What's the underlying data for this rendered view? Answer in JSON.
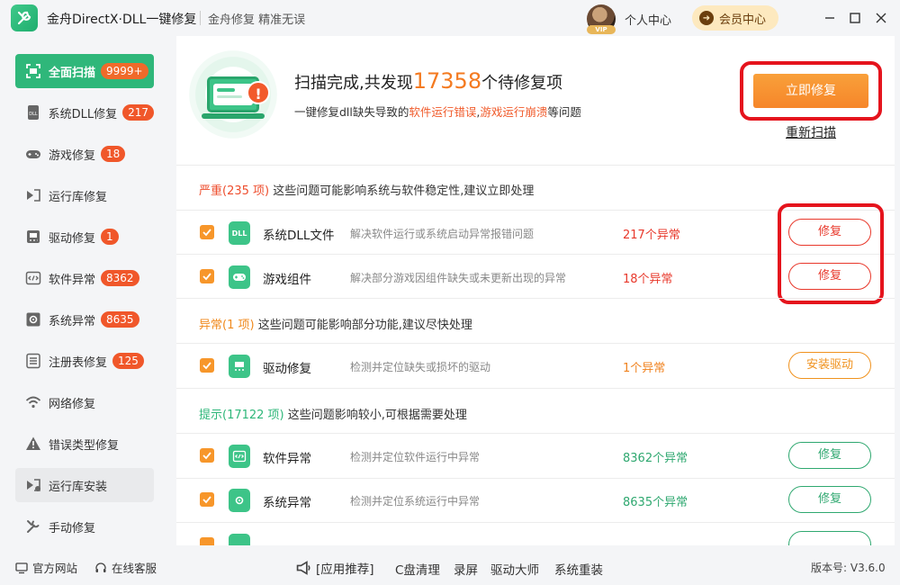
{
  "titlebar": {
    "app_title": "金舟DirectX·DLL一键修复",
    "slogan": "金舟修复 精准无误",
    "vip_tag": "VIP",
    "user_center": "个人中心",
    "member_center": "会员中心"
  },
  "sidebar": {
    "items": [
      {
        "label": "全面扫描",
        "badge": "9999+"
      },
      {
        "label": "系统DLL修复",
        "badge": "217"
      },
      {
        "label": "游戏修复",
        "badge": "18"
      },
      {
        "label": "运行库修复",
        "badge": ""
      },
      {
        "label": "驱动修复",
        "badge": "1"
      },
      {
        "label": "软件异常",
        "badge": "8362"
      },
      {
        "label": "系统异常",
        "badge": "8635"
      },
      {
        "label": "注册表修复",
        "badge": "125"
      },
      {
        "label": "网络修复",
        "badge": ""
      },
      {
        "label": "错误类型修复",
        "badge": ""
      },
      {
        "label": "运行库安装",
        "badge": ""
      },
      {
        "label": "手动修复",
        "badge": ""
      }
    ]
  },
  "summary": {
    "title_prefix": "扫描完成,共发现",
    "count": "17358",
    "title_suffix": "个待修复项",
    "sub_prefix": "一键修复dll缺失导致的",
    "sub_hl1": "软件运行错误",
    "sub_sep": ",",
    "sub_hl2": "游戏运行崩溃",
    "sub_suffix": "等问题",
    "fix_now": "立即修复",
    "rescan": "重新扫描"
  },
  "sections": {
    "severe": {
      "level": "严重(235 项)",
      "desc": "这些问题可能影响系统与软件稳定性,建议立即处理"
    },
    "warn": {
      "level": "异常(1 项)",
      "desc": "这些问题可能影响部分功能,建议尽快处理"
    },
    "tip": {
      "level": "提示(17122 项)",
      "desc": "这些问题影响较小,可根据需要处理"
    }
  },
  "rows": [
    {
      "icon_text": "DLL",
      "name": "系统DLL文件",
      "desc": "解决软件运行或系统启动异常报错问题",
      "count": "217个异常",
      "action": "修复"
    },
    {
      "icon_text": "",
      "name": "游戏组件",
      "desc": "解决部分游戏因组件缺失或未更新出现的异常",
      "count": "18个异常",
      "action": "修复"
    },
    {
      "icon_text": "",
      "name": "驱动修复",
      "desc": "检测并定位缺失或损坏的驱动",
      "count": "1个异常",
      "action": "安装驱动"
    },
    {
      "icon_text": "",
      "name": "软件异常",
      "desc": "检测并定位软件运行中异常",
      "count": "8362个异常",
      "action": "修复"
    },
    {
      "icon_text": "",
      "name": "系统异常",
      "desc": "检测并定位系统运行中异常",
      "count": "8635个异常",
      "action": "修复"
    }
  ],
  "footer": {
    "website": "官方网站",
    "support": "在线客服",
    "recommend": "[应用推荐]",
    "links": [
      "C盘清理",
      "录屏",
      "驱动大师",
      "系统重装"
    ],
    "version": "版本号: V3.6.0"
  },
  "colors": {
    "brand_green": "#2fb77a",
    "accent_orange": "#f6862a",
    "severe_red": "#e8382b",
    "highlight_box": "#e5141d"
  }
}
